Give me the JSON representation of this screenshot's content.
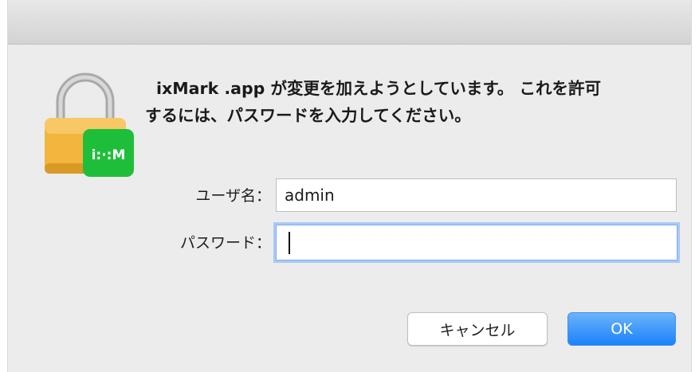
{
  "dialog": {
    "message_line1": "ixMark .app が変更を加えようとしています。 これを許可",
    "message_line2": "するには、パスワードを入力してください。"
  },
  "lock_icon": {
    "badge_text": "i:·:M",
    "badge_color": "#1fbe3a",
    "lock_body_color": "#f3b53d"
  },
  "form": {
    "username_label": "ユーザ名：",
    "username_value": "admin",
    "password_label": "パスワード：",
    "password_value": ""
  },
  "buttons": {
    "cancel_label": "キャンセル",
    "ok_label": "OK"
  },
  "colors": {
    "accent": "#1a82fb",
    "focus_ring": "#a9c9f6"
  }
}
